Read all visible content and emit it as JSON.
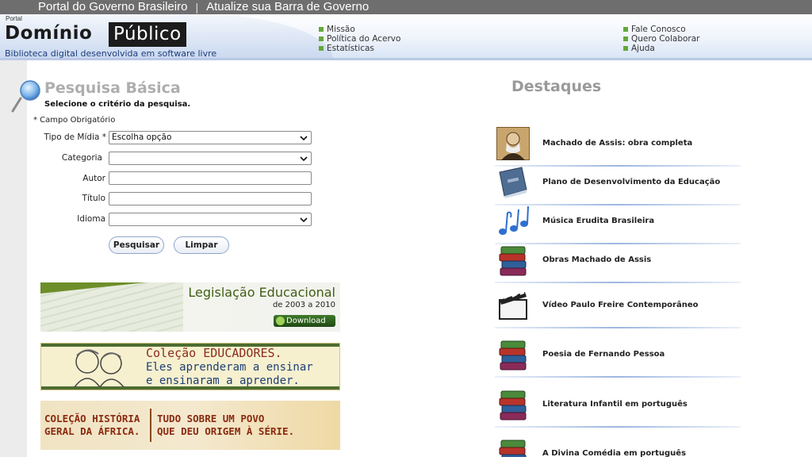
{
  "govbar": {
    "portal": "Portal do Governo Brasileiro",
    "separator": "|",
    "update": "Atualize sua Barra de Governo"
  },
  "header": {
    "portal_word": "Portal",
    "logo_left": "Domínio",
    "logo_right": "Público",
    "tagline": "Biblioteca digital desenvolvida em software livre",
    "menu_left": [
      "Missão",
      "Política do Acervo",
      "Estatísticas"
    ],
    "menu_right": [
      "Fale Conosco",
      "Quero Colaborar",
      "Ajuda"
    ]
  },
  "search": {
    "title": "Pesquisa Básica",
    "subtitle": "Selecione o critério da pesquisa.",
    "required_note": "*  Campo Obrigatório",
    "fields": {
      "tipo_label": "Tipo de Mídia *",
      "tipo_value": "Escolha opção",
      "categoria_label": "Categoria",
      "categoria_value": "",
      "autor_label": "Autor",
      "autor_value": "",
      "titulo_label": "Título",
      "titulo_value": "",
      "idioma_label": "Idioma",
      "idioma_value": ""
    },
    "buttons": {
      "search": "Pesquisar",
      "clear": "Limpar"
    }
  },
  "banners": {
    "legislacao": {
      "title": "Legislação Educacional",
      "subtitle": "de 2003 a 2010",
      "download": "Download"
    },
    "educadores": {
      "line1": "Coleção EDUCADORES.",
      "line2": "Eles aprenderam a ensinar",
      "line3": "e ensinaram a aprender."
    },
    "africa": {
      "left_line1": "COLEÇÃO HISTÓRIA",
      "left_line2": "GERAL DA ÁFRICA.",
      "right_line1": "TUDO SOBRE UM POVO",
      "right_line2": "QUE DEU ORIGEM À SÉRIE."
    }
  },
  "highlights": {
    "title": "Destaques",
    "items": [
      {
        "label": "Machado de Assis: obra completa",
        "icon": "portrait-icon"
      },
      {
        "label": "Plano de Desenvolvimento da Educação",
        "icon": "book-icon"
      },
      {
        "label": "Música Erudita Brasileira",
        "icon": "music-notes-icon"
      },
      {
        "label": "Obras Machado de Assis",
        "icon": "books-stack-icon"
      },
      {
        "label": "Vídeo Paulo Freire Contemporâneo",
        "icon": "clapperboard-icon"
      },
      {
        "label": "Poesia de Fernando Pessoa",
        "icon": "books-stack-icon"
      },
      {
        "label": "Literatura Infantil em português",
        "icon": "books-stack-icon"
      },
      {
        "label": "A Divina Comédia em português",
        "icon": "books-stack-icon"
      }
    ]
  }
}
